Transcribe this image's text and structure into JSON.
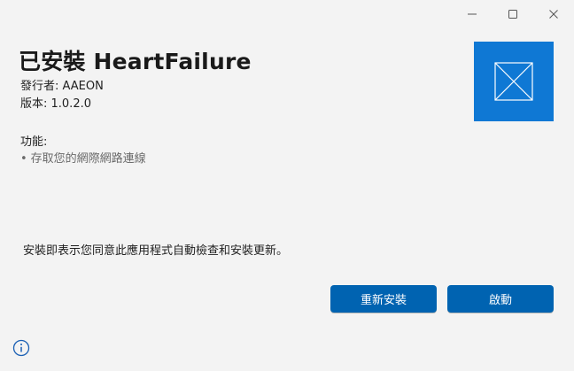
{
  "window_controls": {
    "minimize_icon": "minimize-icon",
    "maximize_icon": "maximize-icon",
    "close_icon": "close-icon"
  },
  "header": {
    "title": "已安裝 HeartFailure",
    "publisher": "發行者: AAEON",
    "version": "版本: 1.0.2.0"
  },
  "capabilities": {
    "heading": "功能:",
    "items": [
      "存取您的網際網路連線"
    ]
  },
  "app_tile": {
    "icon": "placeholder-app-icon",
    "color": "#0f78d4"
  },
  "consent_text": "安裝即表示您同意此應用程式自動檢查和安裝更新。",
  "buttons": {
    "reinstall": "重新安裝",
    "launch": "啟動",
    "accent": "#0063b1"
  },
  "footer": {
    "info_icon": "info-icon",
    "accent": "#1a5fb4"
  }
}
